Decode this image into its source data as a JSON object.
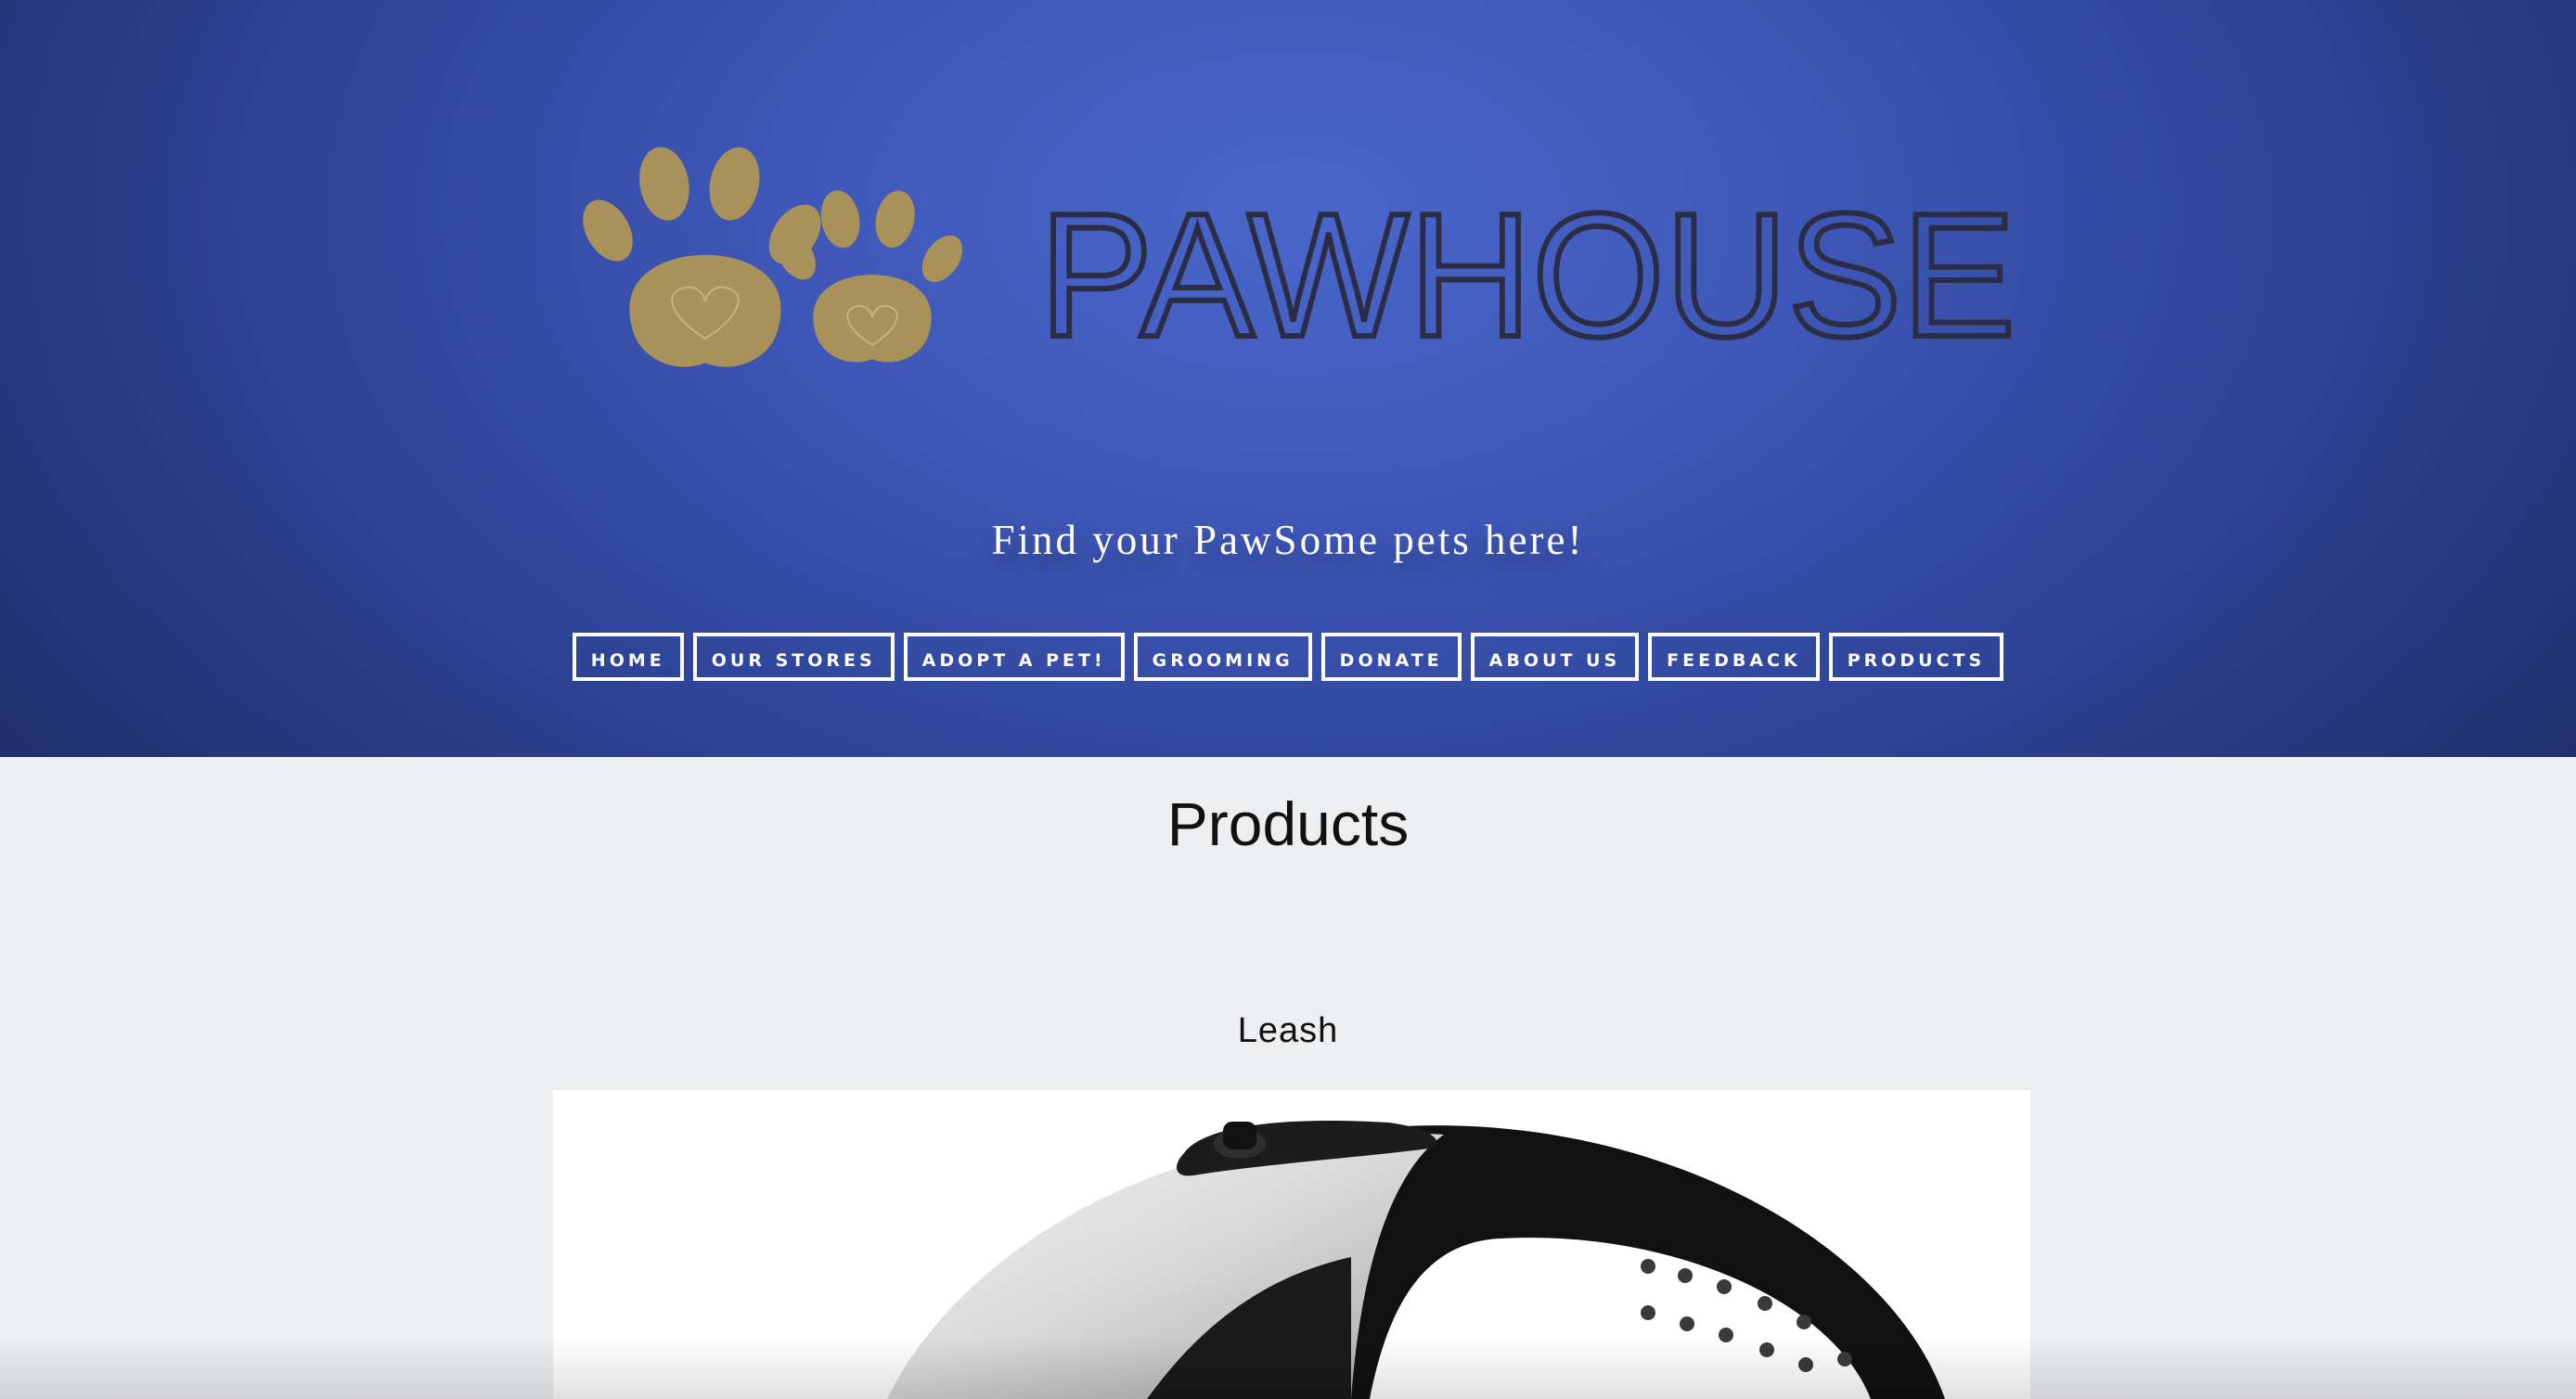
{
  "header": {
    "logo_text": "PAWHOUSE",
    "tagline": "Find your PawSome pets here!",
    "colors": {
      "paw": "#a8925a",
      "logo_text": "#2b2d45",
      "background": "#4a66cb"
    }
  },
  "nav": {
    "items": [
      {
        "label": "HOME"
      },
      {
        "label": "OUR STORES"
      },
      {
        "label": "ADOPT A PET!"
      },
      {
        "label": "GROOMING"
      },
      {
        "label": "DONATE"
      },
      {
        "label": "ABOUT US"
      },
      {
        "label": "FEEDBACK"
      },
      {
        "label": "PRODUCTS"
      }
    ]
  },
  "main": {
    "title": "Products",
    "products": [
      {
        "name": "Leash",
        "icon": "retractable-leash-image"
      }
    ]
  }
}
